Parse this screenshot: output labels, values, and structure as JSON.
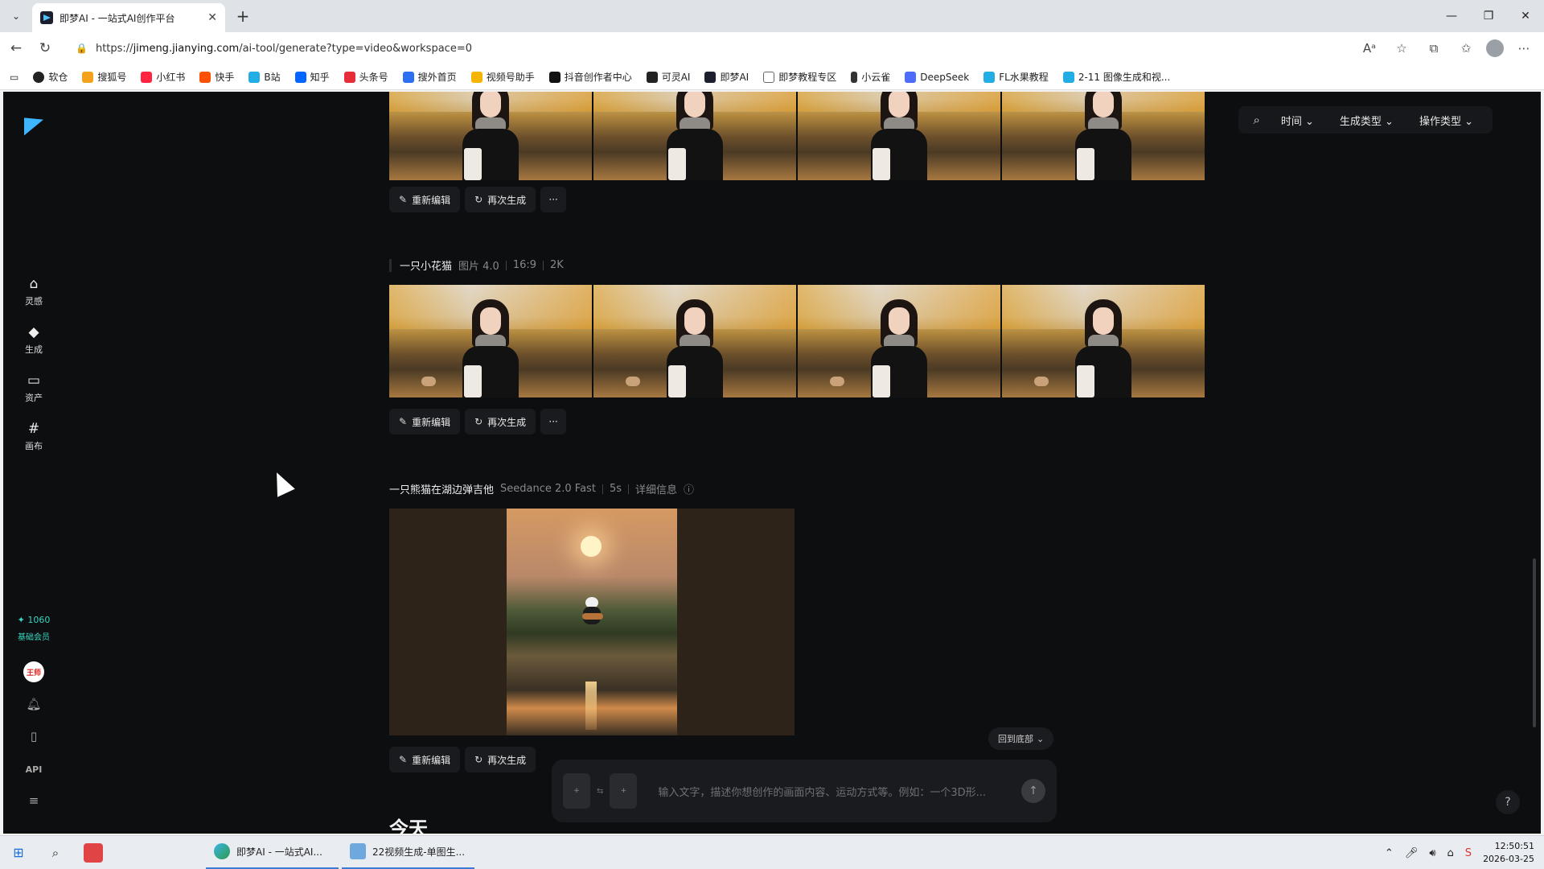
{
  "browser": {
    "tab_title": "即梦AI - 一站式AI创作平台",
    "url_prefix": "https://",
    "url_host": "jimeng.jianying.com",
    "url_path": "/ai-tool/generate?type=video&workspace=0",
    "bookmarks": [
      "软仓",
      "搜狐号",
      "小红书",
      "快手",
      "B站",
      "知乎",
      "头条号",
      "搜外首页",
      "视频号助手",
      "抖音创作者中心",
      "可灵AI",
      "即梦AI",
      "即梦教程专区",
      "小云雀",
      "DeepSeek",
      "FL水果教程",
      "2-11 图像生成和视..."
    ]
  },
  "sidebar": {
    "items": [
      {
        "label": "灵感",
        "icon": "home-icon"
      },
      {
        "label": "生成",
        "icon": "diamond-icon"
      },
      {
        "label": "资产",
        "icon": "folder-icon"
      },
      {
        "label": "画布",
        "icon": "canvas-icon"
      }
    ],
    "credits": "✦ 1060",
    "tier": "基础会员",
    "avatar_text": "王师",
    "api_label": "API"
  },
  "filters": {
    "time": "时间",
    "gen_type": "生成类型",
    "op_type": "操作类型"
  },
  "actions": {
    "reedit": "重新编辑",
    "regen": "再次生成",
    "more": "···"
  },
  "groups": [
    {
      "prompt": "一只小花猫",
      "model": "图片 4.0",
      "ratio": "16:9",
      "resolution": "2K"
    },
    {
      "prompt": "一只熊猫在湖边弹吉他",
      "model": "Seedance 2.0 Fast",
      "duration": "5s",
      "detail": "详细信息"
    }
  ],
  "back_to_bottom": "回到底部",
  "composer": {
    "placeholder": "输入文字，描述你想创作的画面内容、运动方式等。例如：一个3D形..."
  },
  "section_today": "今天",
  "taskbar": {
    "win1": "即梦AI - 一站式AI...",
    "win2": "22视频生成-单图生...",
    "time": "12:50:51",
    "date": "2026-03-25"
  }
}
